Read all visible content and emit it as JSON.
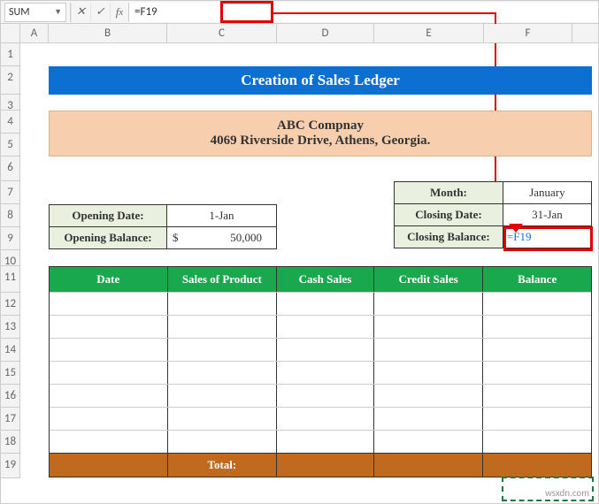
{
  "namebox": "SUM",
  "formula": "=F19",
  "columns": [
    "A",
    "B",
    "C",
    "D",
    "E",
    "F"
  ],
  "rows": [
    "1",
    "2",
    "3",
    "4",
    "5",
    "6",
    "7",
    "8",
    "9",
    "10",
    "11",
    "12",
    "13",
    "14",
    "15",
    "16",
    "17",
    "18",
    "19"
  ],
  "title": "Creation of Sales Ledger",
  "company_name": "ABC Compnay",
  "company_addr": "4069 Riverside Drive, Athens, Georgia.",
  "opening": {
    "date_label": "Opening Date:",
    "date_value": "1-Jan",
    "bal_label": "Opening Balance:",
    "bal_value": "50,000"
  },
  "closing": {
    "month_label": "Month:",
    "month_value": "January",
    "date_label": "Closing Date:",
    "date_value": "31-Jan",
    "bal_label": "Closing Balance:",
    "bal_value": "=F19"
  },
  "table": {
    "headers": {
      "date": "Date",
      "prod": "Sales of Product",
      "cash": "Cash Sales",
      "cred": "Credit Sales",
      "bal": "Balance"
    },
    "total_label": "Total:"
  },
  "watermark": "wsxdn.com",
  "chart_data": {
    "type": "table",
    "title": "Creation of Sales Ledger",
    "columns": [
      "Date",
      "Sales of Product",
      "Cash Sales",
      "Credit Sales",
      "Balance"
    ],
    "rows": [
      [],
      [],
      [],
      [],
      [],
      [],
      []
    ],
    "totals": [
      "",
      "",
      "",
      "",
      ""
    ],
    "opening_balance": 50000,
    "opening_date": "1-Jan",
    "closing_date": "31-Jan",
    "month": "January",
    "closing_balance_formula": "=F19"
  }
}
